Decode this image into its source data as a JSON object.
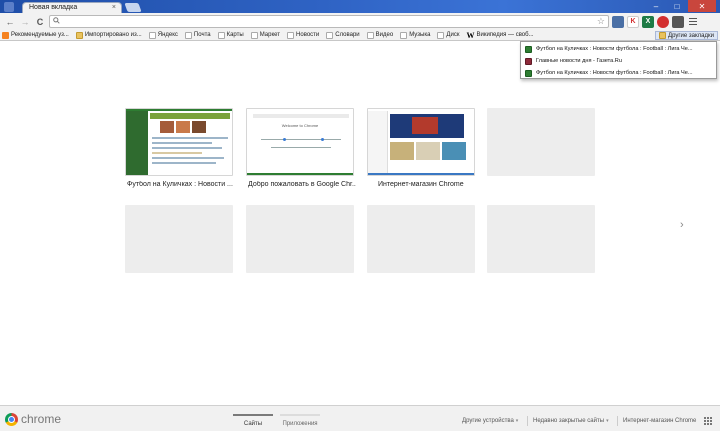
{
  "tabs": [
    {
      "label": "Новая вкладка",
      "close": "×"
    }
  ],
  "window_controls": {
    "minimize": "–",
    "maximize": "□",
    "close": "✕"
  },
  "toolbar": {
    "back": "←",
    "forward": "→",
    "reload": "C",
    "omnibox_value": "",
    "extensions": [
      {
        "name": "translate-extension-icon",
        "text": "",
        "color": "#4a6fa5"
      },
      {
        "name": "kaspersky-extension-icon",
        "text": "K",
        "color": "#d32f2f"
      },
      {
        "name": "excel-extension-icon",
        "text": "X",
        "color": "#1e7b46"
      },
      {
        "name": "opera-extension-icon",
        "text": "",
        "color": "#d32f2f"
      },
      {
        "name": "rss-extension-icon",
        "text": "",
        "color": "#555555"
      }
    ]
  },
  "bookmarks": {
    "items": [
      {
        "label": "Рекомендуемые уз...",
        "icon": "orange"
      },
      {
        "label": "Импортировано из...",
        "icon": "folder"
      },
      {
        "label": "Яндекс",
        "icon": "page"
      },
      {
        "label": "Почта",
        "icon": "page"
      },
      {
        "label": "Карты",
        "icon": "page"
      },
      {
        "label": "Маркет",
        "icon": "page"
      },
      {
        "label": "Новости",
        "icon": "page"
      },
      {
        "label": "Словари",
        "icon": "page"
      },
      {
        "label": "Видео",
        "icon": "page"
      },
      {
        "label": "Музыка",
        "icon": "page"
      },
      {
        "label": "Диск",
        "icon": "page"
      },
      {
        "label": "Википедия — своб...",
        "icon": "w"
      }
    ],
    "other": "Другие закладки",
    "wikipedia_glyph": "W"
  },
  "other_bookmarks_menu": [
    {
      "label": "Футбол на Куличках : Новости футбола : Football : Лига Че...",
      "icon": "green"
    },
    {
      "label": "Главные новости дня - Газета.Ru",
      "icon": "red"
    },
    {
      "label": "Футбол на Куличках : Новости футбола : Football : Лига Че...",
      "icon": "green"
    }
  ],
  "most_visited": [
    {
      "title": "Футбол на Куличках : Новости ...",
      "color": "#2e7d32"
    },
    {
      "title": "Добро пожаловать в Google Chr...",
      "color": "#2e7d32"
    },
    {
      "title": "Интернет-магазин Chrome",
      "color": "#3a78c3"
    }
  ],
  "thumb_text": {
    "welcome_title": "Welcome to Chrome"
  },
  "next_arrow": "›",
  "footer": {
    "brand": "chrome",
    "tabs": [
      {
        "label": "Сайты",
        "active": true
      },
      {
        "label": "Приложения",
        "active": false
      }
    ],
    "links": [
      {
        "label": "Другие устройства"
      },
      {
        "label": "Недавно закрытые сайты"
      },
      {
        "label": "Интернет-магазин Chrome"
      }
    ],
    "caret": "▾"
  }
}
